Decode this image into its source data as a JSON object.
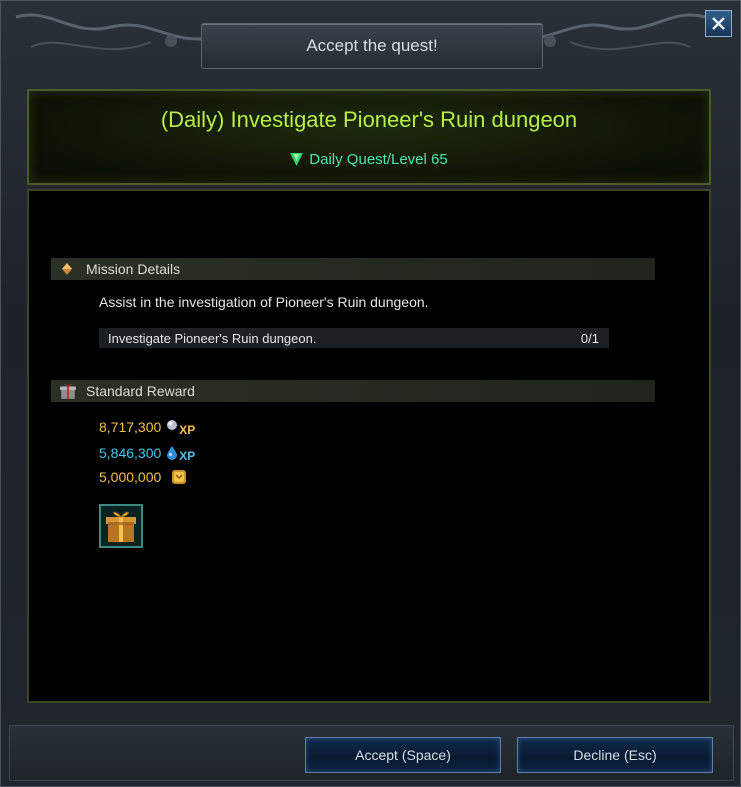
{
  "window": {
    "title": "Accept the quest!",
    "close_icon": "close-icon"
  },
  "quest": {
    "title": "(Daily) Investigate Pioneer's Ruin dungeon",
    "subtitle": "Daily Quest/Level 65",
    "subtitle_icon": "green-triangle-icon"
  },
  "mission": {
    "header": "Mission Details",
    "header_icon": "diamond-icon",
    "description": "Assist in the investigation of Pioneer's Ruin dungeon.",
    "objective": {
      "text": "Investigate Pioneer's Ruin dungeon.",
      "progress": "0/1"
    }
  },
  "reward": {
    "header": "Standard Reward",
    "header_icon": "gift-box-icon",
    "items": [
      {
        "value": "8,717,300",
        "tag": "XP",
        "icon": "silver-orb-xp-icon",
        "color": "#f3c04a"
      },
      {
        "value": "5,846,300",
        "tag": "XP",
        "icon": "blue-drop-xp-icon",
        "color": "#43c4ee"
      },
      {
        "value": "5,000,000",
        "tag": "",
        "icon": "gold-coin-icon",
        "color": "#f3c04a"
      }
    ],
    "item_slot_icon": "gift-box-item-icon"
  },
  "buttons": {
    "accept": "Accept (Space)",
    "decline": "Decline (Esc)"
  },
  "colors": {
    "quest_title": "#b7ee45",
    "quest_subtitle": "#4fe3b2",
    "gold_text": "#f3c04a",
    "blue_text": "#43c4ee"
  }
}
